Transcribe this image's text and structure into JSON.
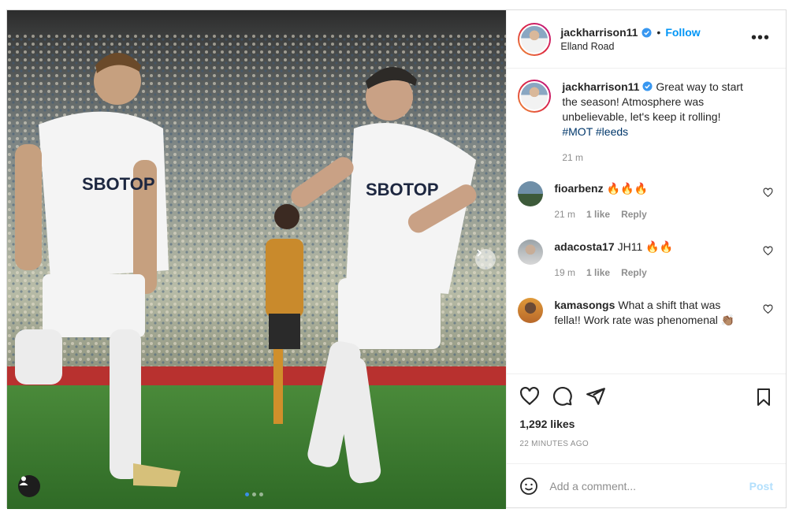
{
  "post": {
    "username": "jackharrison11",
    "follow_label": "Follow",
    "separator": "•",
    "location": "Elland Road",
    "more_label": "•••",
    "photo_alt": "Photo by jackharrison11",
    "shirt_sponsor": "SBOTOP"
  },
  "caption": {
    "username": "jackharrison11",
    "text": "Great way to start the season! Atmosphere was unbelievable, let's keep it rolling!",
    "hashtags": "#MOT #leeds",
    "time": "21 m"
  },
  "comments": [
    {
      "username": "fioarbenz",
      "text": "🔥🔥🔥",
      "time": "21 m",
      "likes": "1 like",
      "reply": "Reply"
    },
    {
      "username": "adacosta17",
      "text": "JH11 🔥🔥",
      "time": "19 m",
      "likes": "1 like",
      "reply": "Reply"
    },
    {
      "username": "kamasongs",
      "text": "What a shift that was fella!! Work rate was phenomenal 👏🏽",
      "time": "",
      "likes": "",
      "reply": ""
    }
  ],
  "stats": {
    "likes": "1,292 likes",
    "posted": "22 MINUTES AGO"
  },
  "add_comment": {
    "placeholder": "Add a comment...",
    "post_label": "Post"
  },
  "icons": {
    "like": "heart-icon",
    "comment": "comment-icon",
    "share": "share-icon",
    "save": "bookmark-icon",
    "emoji": "emoji-icon",
    "verified": "verified-badge-icon"
  },
  "colors": {
    "link": "#0095f6",
    "hashtag": "#00376b",
    "muted": "#8e8e8e",
    "post_disabled": "#b2dffc"
  }
}
